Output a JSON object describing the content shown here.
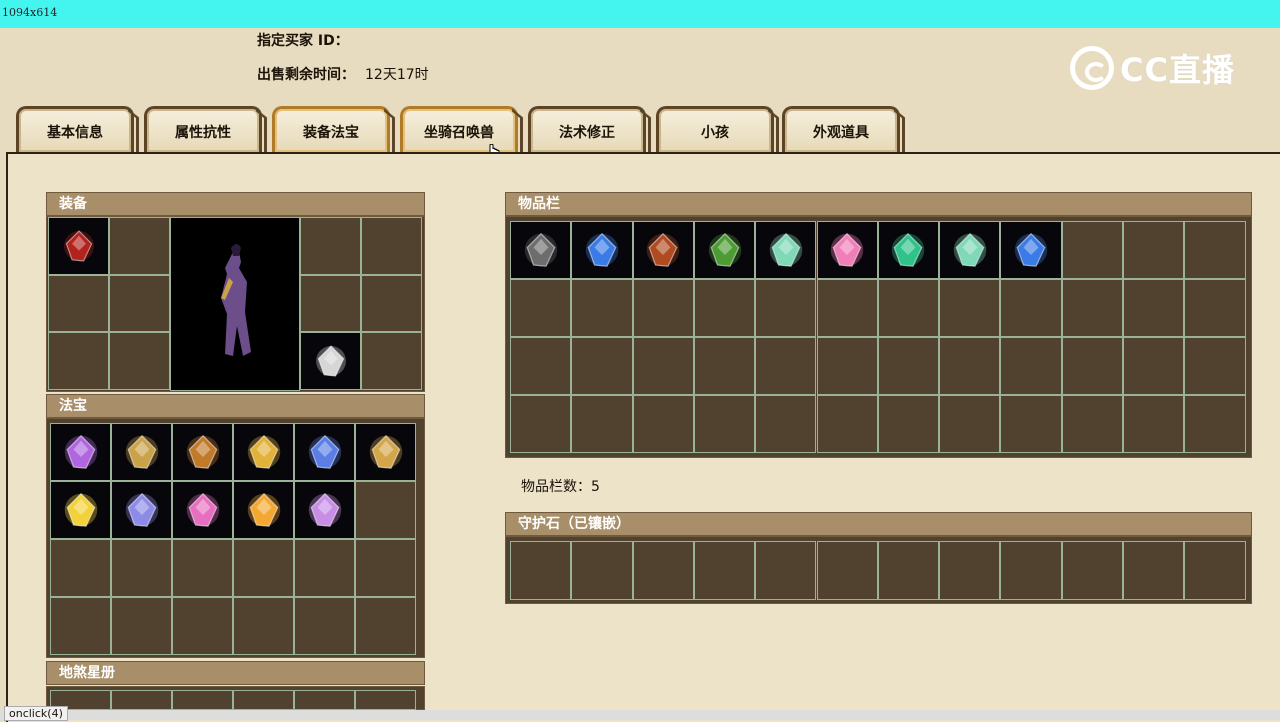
{
  "window": {
    "dimension_label": "1094x614"
  },
  "info": {
    "buyer_label": "指定买家 ID：",
    "time_label": "出售剩余时间：",
    "time_value": "12天17时"
  },
  "logo": {
    "text": "CC直播"
  },
  "tabs": [
    {
      "label": "基本信息",
      "active": false
    },
    {
      "label": "属性抗性",
      "active": false
    },
    {
      "label": "装备法宝",
      "active": true
    },
    {
      "label": "坐骑召唤兽",
      "active": false
    },
    {
      "label": "法术修正",
      "active": false
    },
    {
      "label": "小孩",
      "active": false
    },
    {
      "label": "外观道具",
      "active": false
    }
  ],
  "sections": {
    "equipment": "装备",
    "treasure": "法宝",
    "star_book": "地煞星册",
    "inventory": "物品栏",
    "inventory_count_label": "物品栏数：",
    "inventory_count_value": "5",
    "guard_stone": "守护石（已镶嵌）"
  },
  "inventory_items": [
    {
      "icon": "dark-armor-icon",
      "color": "#6d6d6d"
    },
    {
      "icon": "blue-gem-icon",
      "color": "#3a7be6"
    },
    {
      "icon": "axe-icon",
      "color": "#b04a20"
    },
    {
      "icon": "green-wreath-icon",
      "color": "#4c9b34"
    },
    {
      "icon": "green-card-icon",
      "color": "#7fd8b6"
    },
    {
      "icon": "pink-heart-icon",
      "color": "#f07fb8"
    },
    {
      "icon": "green-drop-gem-icon",
      "color": "#2fc28a"
    },
    {
      "icon": "green-card-icon",
      "color": "#7fd8b6"
    },
    {
      "icon": "blue-gem-icon",
      "color": "#3a7be6"
    }
  ],
  "treasure_items": [
    {
      "icon": "purple-glove-icon",
      "color": "#b066e0"
    },
    {
      "icon": "golden-scroll-icon",
      "color": "#c9a24a"
    },
    {
      "icon": "lute-icon",
      "color": "#c07a2a"
    },
    {
      "icon": "golden-tower-icon",
      "color": "#e2b23a"
    },
    {
      "icon": "blue-claw-icon",
      "color": "#5a7ee6"
    },
    {
      "icon": "golden-whip-icon",
      "color": "#d4a64a"
    },
    {
      "icon": "yellow-ring-icon",
      "color": "#f2d23a"
    },
    {
      "icon": "blue-fan-icon",
      "color": "#8d8be8"
    },
    {
      "icon": "pink-lantern-icon",
      "color": "#e66fc0"
    },
    {
      "icon": "golden-fan-icon",
      "color": "#f3a832"
    },
    {
      "icon": "purple-bottle-icon",
      "color": "#c88ee6"
    }
  ],
  "equipment_items": [
    {
      "icon": "red-robe-icon",
      "color": "#b2231e"
    },
    {
      "icon": "silver-belt-icon",
      "color": "#d6d6d6"
    }
  ],
  "status": {
    "text": "onclick(4)"
  },
  "colors": {
    "cell_bg": "#50422e",
    "cell_border": "#9ab398",
    "title_bar": "#a88f6a",
    "page_bg": "#e7dcbf"
  }
}
